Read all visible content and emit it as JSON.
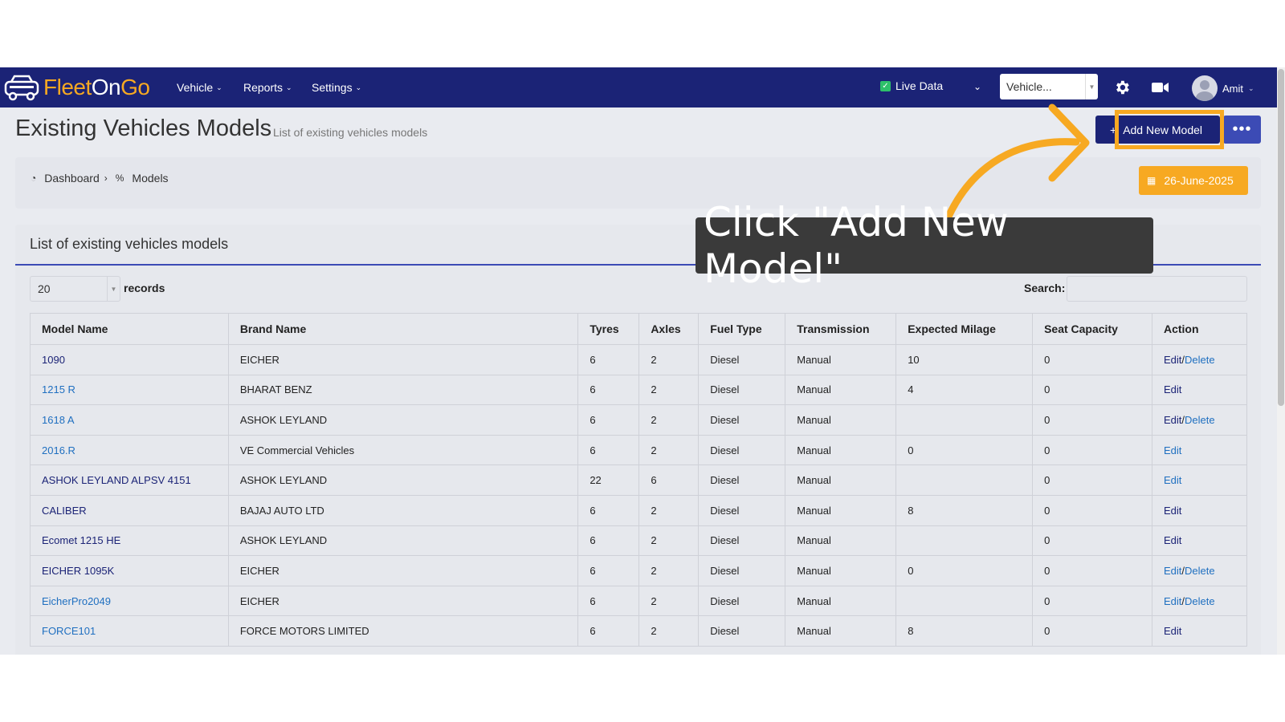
{
  "nav": {
    "logo_part1": "Fleet",
    "logo_part2": "On",
    "logo_part3": "Go",
    "menus": [
      {
        "label": "Vehicle"
      },
      {
        "label": "Reports"
      },
      {
        "label": "Settings"
      }
    ],
    "live_data_label": "Live Data",
    "vehicle_select_value": "Vehicle...",
    "user_name": "Amit",
    "chevron_glyph": "⌄"
  },
  "header": {
    "title": "Existing Vehicles Models",
    "subtitle": "List of existing vehicles models",
    "add_button": "Add New Model",
    "more_button": "•••"
  },
  "breadcrumb": {
    "home": "Dashboard",
    "current": "Models",
    "separator": "›"
  },
  "date_label": "26-June-2025",
  "card": {
    "title": "List of existing vehicles models",
    "page_length_value": "20",
    "page_length_label": "records",
    "search_label": "Search:"
  },
  "table": {
    "columns": [
      "Model Name",
      "Brand Name",
      "Tyres",
      "Axles",
      "Fuel Type",
      "Transmission",
      "Expected Milage",
      "Seat Capacity",
      "Action"
    ],
    "rows": [
      {
        "model": "1090",
        "brand": "EICHER",
        "tyres": "6",
        "axles": "2",
        "fuel": "Diesel",
        "transmission": "Manual",
        "milage": "10",
        "seats": "0",
        "edit": "Edit",
        "delete": "Delete"
      },
      {
        "model": "1215 R",
        "brand": "BHARAT BENZ",
        "tyres": "6",
        "axles": "2",
        "fuel": "Diesel",
        "transmission": "Manual",
        "milage": "4",
        "seats": "0",
        "edit": "Edit",
        "delete": ""
      },
      {
        "model": "1618 A",
        "brand": "ASHOK LEYLAND",
        "tyres": "6",
        "axles": "2",
        "fuel": "Diesel",
        "transmission": "Manual",
        "milage": "",
        "seats": "0",
        "edit": "Edit",
        "delete": "Delete"
      },
      {
        "model": "2016.R",
        "brand": "VE Commercial Vehicles",
        "tyres": "6",
        "axles": "2",
        "fuel": "Diesel",
        "transmission": "Manual",
        "milage": "0",
        "seats": "0",
        "edit": "Edit",
        "delete": ""
      },
      {
        "model": "ASHOK LEYLAND ALPSV 4151",
        "brand": "ASHOK LEYLAND",
        "tyres": "22",
        "axles": "6",
        "fuel": "Diesel",
        "transmission": "Manual",
        "milage": "",
        "seats": "0",
        "edit": "Edit",
        "delete": ""
      },
      {
        "model": "CALIBER",
        "brand": "BAJAJ AUTO LTD",
        "tyres": "6",
        "axles": "2",
        "fuel": "Diesel",
        "transmission": "Manual",
        "milage": "8",
        "seats": "0",
        "edit": "Edit",
        "delete": ""
      },
      {
        "model": "Ecomet 1215 HE",
        "brand": "ASHOK LEYLAND",
        "tyres": "6",
        "axles": "2",
        "fuel": "Diesel",
        "transmission": "Manual",
        "milage": "",
        "seats": "0",
        "edit": "Edit",
        "delete": ""
      },
      {
        "model": "EICHER 1095K",
        "brand": "EICHER",
        "tyres": "6",
        "axles": "2",
        "fuel": "Diesel",
        "transmission": "Manual",
        "milage": "0",
        "seats": "0",
        "edit": "Edit",
        "delete": "Delete"
      },
      {
        "model": "EicherPro2049",
        "brand": "EICHER",
        "tyres": "6",
        "axles": "2",
        "fuel": "Diesel",
        "transmission": "Manual",
        "milage": "",
        "seats": "0",
        "edit": "Edit",
        "delete": "Delete"
      },
      {
        "model": "FORCE101",
        "brand": "FORCE MOTORS LIMITED",
        "tyres": "6",
        "axles": "2",
        "fuel": "Diesel",
        "transmission": "Manual",
        "milage": "8",
        "seats": "0",
        "edit": "Edit",
        "delete": ""
      }
    ]
  },
  "overlay": {
    "instruction": "Click \"Add New Model\""
  },
  "colors": {
    "nav_bg": "#1b2376",
    "accent_orange": "#f7a922",
    "link_blue": "#1f6fc0",
    "tooltip_bg": "#3a3a3a"
  }
}
